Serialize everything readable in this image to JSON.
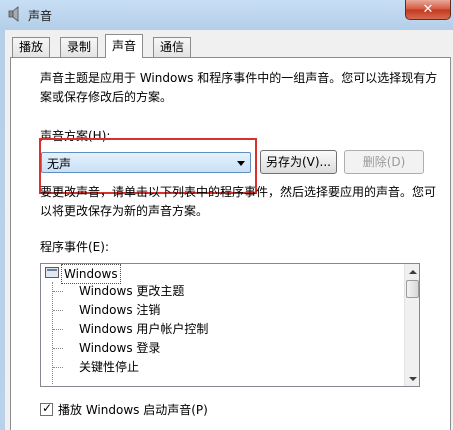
{
  "window": {
    "title": "声音",
    "close_glyph": "✕"
  },
  "tabs": [
    {
      "label": "播放"
    },
    {
      "label": "录制"
    },
    {
      "label": "声音"
    },
    {
      "label": "通信"
    }
  ],
  "sounds": {
    "description_line1": "声音主题是应用于 Windows 和程序事件中的一组声音。您可以选择现有方",
    "description_line2": "案或保存修改后的方案。",
    "scheme_label": "声音方案(H):",
    "scheme_value": "无声",
    "save_as_label": "另存为(V)...",
    "delete_label": "删除(D)",
    "instructions_line1": "要更改声音，请单击以下列表中的程序事件，然后选择要应用的声音。您可",
    "instructions_line2": "以将更改保存为新的声音方案。",
    "events_label": "程序事件(E):",
    "events": [
      {
        "label": "Windows"
      },
      {
        "label": "Windows 更改主题"
      },
      {
        "label": "Windows 注销"
      },
      {
        "label": "Windows 用户帐户控制"
      },
      {
        "label": "Windows 登录"
      },
      {
        "label": "关键性停止"
      }
    ],
    "startup_checkbox_label": "播放 Windows 启动声音(P)",
    "startup_checked": true
  },
  "colors": {
    "highlight_border": "#d9312d",
    "close_button": "#c2371d"
  }
}
